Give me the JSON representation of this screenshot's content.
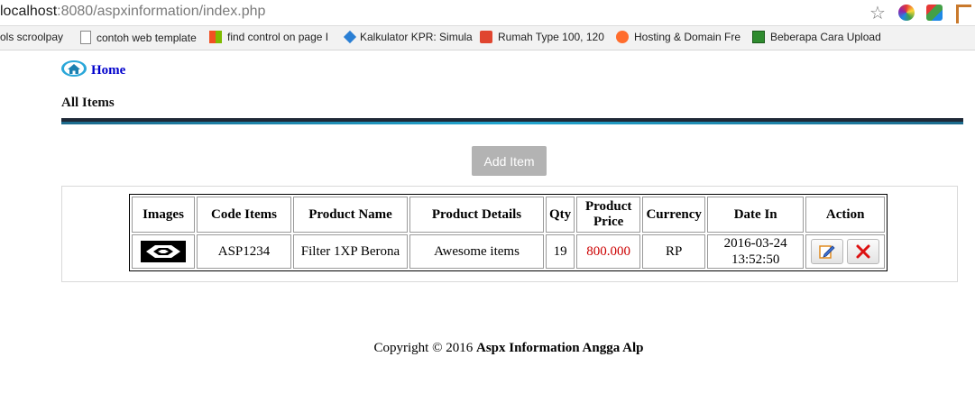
{
  "browser": {
    "url_host": "localhost",
    "url_rest": ":8080/aspxinformation/index.php"
  },
  "bookmarks": [
    {
      "label": "ols scroolpay",
      "icon": "none"
    },
    {
      "label": "contoh web template",
      "icon": "page-icon"
    },
    {
      "label": "find control on page I",
      "icon": "windows-icon"
    },
    {
      "label": "Kalkulator KPR: Simula",
      "icon": "diamond-icon"
    },
    {
      "label": "Rumah Type 100, 120",
      "icon": "rp-icon"
    },
    {
      "label": "Hosting & Domain Fre",
      "icon": "cpanel-icon"
    },
    {
      "label": "Beberapa Cara Upload",
      "icon": "green-icon"
    }
  ],
  "nav": {
    "home_label": "Home"
  },
  "section_title": "All Items",
  "add_button_label": "Add Item",
  "table": {
    "headers": [
      "Images",
      "Code Items",
      "Product Name",
      "Product Details",
      "Qty",
      "Product Price",
      "Currency",
      "Date In",
      "Action"
    ],
    "rows": [
      {
        "code": "ASP1234",
        "name": "Filter 1XP Berona",
        "details": "Awesome items",
        "qty": "19",
        "price": "800.000",
        "currency": "RP",
        "date": "2016-03-24",
        "time": "13:52:50"
      }
    ]
  },
  "footer": {
    "prefix": "Copyright  © 2016 ",
    "brand": "Aspx Information Angga Alp"
  },
  "colors": {
    "link": "#0000cc",
    "price": "#cc0000",
    "button_bg": "#b3b3b3"
  }
}
